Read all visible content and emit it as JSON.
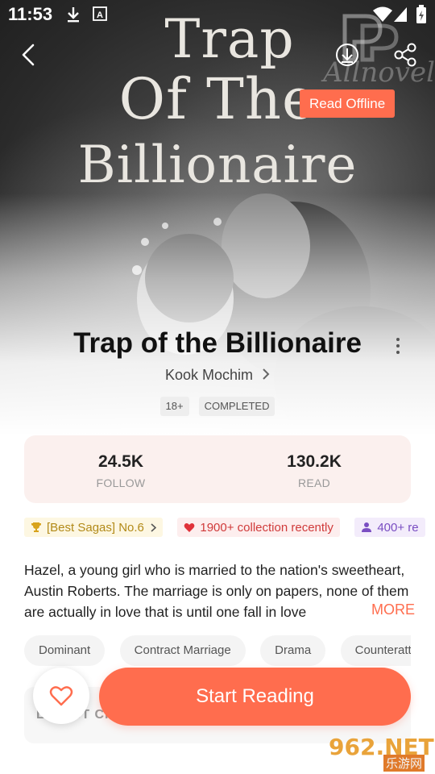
{
  "status_bar": {
    "time": "11:53"
  },
  "cover": {
    "line1": "Trap",
    "line2": "Of The",
    "line3": "Billionaire",
    "brand_watermark": "Allnovel"
  },
  "header": {
    "read_offline": "Read Offline"
  },
  "book": {
    "title": "Trap of the Billionaire",
    "author": "Kook Mochim",
    "badges": [
      "18+",
      "COMPLETED"
    ]
  },
  "stats": {
    "follow_value": "24.5K",
    "follow_label": "FOLLOW",
    "read_value": "130.2K",
    "read_label": "READ"
  },
  "chips": {
    "rank": "[Best Sagas] No.6",
    "collection": "1900+ collection recently",
    "readers": "400+ re"
  },
  "description": {
    "text": "Hazel, a young girl who is married to the nation's sweetheart, Austin Roberts. The marriage is only on papers, none of them are actually in love that is until one fall in love",
    "more": "MORE"
  },
  "genres": [
    "Dominant",
    "Contract Marriage",
    "Drama",
    "Counterattack"
  ],
  "latest": {
    "label": "LATEST CHAPTER"
  },
  "actions": {
    "start_reading": "Start Reading"
  },
  "site_watermark": {
    "number": "962.NET",
    "chinese": "乐游网"
  },
  "colors": {
    "accent": "#ff6d4e",
    "stats_bg": "#fbf0ee"
  }
}
